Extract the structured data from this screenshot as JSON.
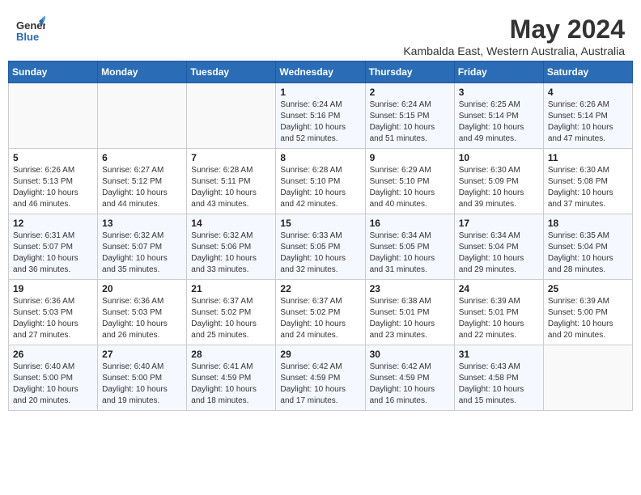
{
  "header": {
    "logo_line1": "General",
    "logo_line2": "Blue",
    "month": "May 2024",
    "location": "Kambalda East, Western Australia, Australia"
  },
  "weekdays": [
    "Sunday",
    "Monday",
    "Tuesday",
    "Wednesday",
    "Thursday",
    "Friday",
    "Saturday"
  ],
  "weeks": [
    [
      {
        "day": "",
        "info": ""
      },
      {
        "day": "",
        "info": ""
      },
      {
        "day": "",
        "info": ""
      },
      {
        "day": "1",
        "info": "Sunrise: 6:24 AM\nSunset: 5:16 PM\nDaylight: 10 hours and 52 minutes."
      },
      {
        "day": "2",
        "info": "Sunrise: 6:24 AM\nSunset: 5:15 PM\nDaylight: 10 hours and 51 minutes."
      },
      {
        "day": "3",
        "info": "Sunrise: 6:25 AM\nSunset: 5:14 PM\nDaylight: 10 hours and 49 minutes."
      },
      {
        "day": "4",
        "info": "Sunrise: 6:26 AM\nSunset: 5:14 PM\nDaylight: 10 hours and 47 minutes."
      }
    ],
    [
      {
        "day": "5",
        "info": "Sunrise: 6:26 AM\nSunset: 5:13 PM\nDaylight: 10 hours and 46 minutes."
      },
      {
        "day": "6",
        "info": "Sunrise: 6:27 AM\nSunset: 5:12 PM\nDaylight: 10 hours and 44 minutes."
      },
      {
        "day": "7",
        "info": "Sunrise: 6:28 AM\nSunset: 5:11 PM\nDaylight: 10 hours and 43 minutes."
      },
      {
        "day": "8",
        "info": "Sunrise: 6:28 AM\nSunset: 5:10 PM\nDaylight: 10 hours and 42 minutes."
      },
      {
        "day": "9",
        "info": "Sunrise: 6:29 AM\nSunset: 5:10 PM\nDaylight: 10 hours and 40 minutes."
      },
      {
        "day": "10",
        "info": "Sunrise: 6:30 AM\nSunset: 5:09 PM\nDaylight: 10 hours and 39 minutes."
      },
      {
        "day": "11",
        "info": "Sunrise: 6:30 AM\nSunset: 5:08 PM\nDaylight: 10 hours and 37 minutes."
      }
    ],
    [
      {
        "day": "12",
        "info": "Sunrise: 6:31 AM\nSunset: 5:07 PM\nDaylight: 10 hours and 36 minutes."
      },
      {
        "day": "13",
        "info": "Sunrise: 6:32 AM\nSunset: 5:07 PM\nDaylight: 10 hours and 35 minutes."
      },
      {
        "day": "14",
        "info": "Sunrise: 6:32 AM\nSunset: 5:06 PM\nDaylight: 10 hours and 33 minutes."
      },
      {
        "day": "15",
        "info": "Sunrise: 6:33 AM\nSunset: 5:05 PM\nDaylight: 10 hours and 32 minutes."
      },
      {
        "day": "16",
        "info": "Sunrise: 6:34 AM\nSunset: 5:05 PM\nDaylight: 10 hours and 31 minutes."
      },
      {
        "day": "17",
        "info": "Sunrise: 6:34 AM\nSunset: 5:04 PM\nDaylight: 10 hours and 29 minutes."
      },
      {
        "day": "18",
        "info": "Sunrise: 6:35 AM\nSunset: 5:04 PM\nDaylight: 10 hours and 28 minutes."
      }
    ],
    [
      {
        "day": "19",
        "info": "Sunrise: 6:36 AM\nSunset: 5:03 PM\nDaylight: 10 hours and 27 minutes."
      },
      {
        "day": "20",
        "info": "Sunrise: 6:36 AM\nSunset: 5:03 PM\nDaylight: 10 hours and 26 minutes."
      },
      {
        "day": "21",
        "info": "Sunrise: 6:37 AM\nSunset: 5:02 PM\nDaylight: 10 hours and 25 minutes."
      },
      {
        "day": "22",
        "info": "Sunrise: 6:37 AM\nSunset: 5:02 PM\nDaylight: 10 hours and 24 minutes."
      },
      {
        "day": "23",
        "info": "Sunrise: 6:38 AM\nSunset: 5:01 PM\nDaylight: 10 hours and 23 minutes."
      },
      {
        "day": "24",
        "info": "Sunrise: 6:39 AM\nSunset: 5:01 PM\nDaylight: 10 hours and 22 minutes."
      },
      {
        "day": "25",
        "info": "Sunrise: 6:39 AM\nSunset: 5:00 PM\nDaylight: 10 hours and 20 minutes."
      }
    ],
    [
      {
        "day": "26",
        "info": "Sunrise: 6:40 AM\nSunset: 5:00 PM\nDaylight: 10 hours and 20 minutes."
      },
      {
        "day": "27",
        "info": "Sunrise: 6:40 AM\nSunset: 5:00 PM\nDaylight: 10 hours and 19 minutes."
      },
      {
        "day": "28",
        "info": "Sunrise: 6:41 AM\nSunset: 4:59 PM\nDaylight: 10 hours and 18 minutes."
      },
      {
        "day": "29",
        "info": "Sunrise: 6:42 AM\nSunset: 4:59 PM\nDaylight: 10 hours and 17 minutes."
      },
      {
        "day": "30",
        "info": "Sunrise: 6:42 AM\nSunset: 4:59 PM\nDaylight: 10 hours and 16 minutes."
      },
      {
        "day": "31",
        "info": "Sunrise: 6:43 AM\nSunset: 4:58 PM\nDaylight: 10 hours and 15 minutes."
      },
      {
        "day": "",
        "info": ""
      }
    ]
  ]
}
